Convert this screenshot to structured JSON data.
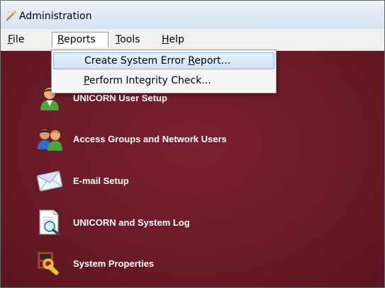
{
  "window": {
    "title": "Administration"
  },
  "menubar": {
    "items": [
      {
        "pre": "",
        "mn": "F",
        "post": "ile"
      },
      {
        "pre": "",
        "mn": "R",
        "post": "eports"
      },
      {
        "pre": "",
        "mn": "T",
        "post": "ools"
      },
      {
        "pre": "",
        "mn": "H",
        "post": "elp"
      }
    ]
  },
  "reports_menu": {
    "items": [
      {
        "pre": "Create System Error ",
        "mn": "R",
        "post": "eport..."
      },
      {
        "pre": "",
        "mn": "P",
        "post": "erform Integrity Check..."
      }
    ]
  },
  "apps": {
    "items": [
      {
        "label": "UNICORN User Setup",
        "icon": "user-icon"
      },
      {
        "label": "Access Groups and Network Users",
        "icon": "users-group-icon"
      },
      {
        "label": "E-mail Setup",
        "icon": "envelope-icon"
      },
      {
        "label": "UNICORN and System Log",
        "icon": "log-search-icon"
      },
      {
        "label": "System Properties",
        "icon": "system-properties-icon"
      }
    ]
  },
  "colors": {
    "background": "#6e1a26",
    "menu_highlight": "#cfe3f7",
    "titlebar": "#d6e3f1"
  }
}
